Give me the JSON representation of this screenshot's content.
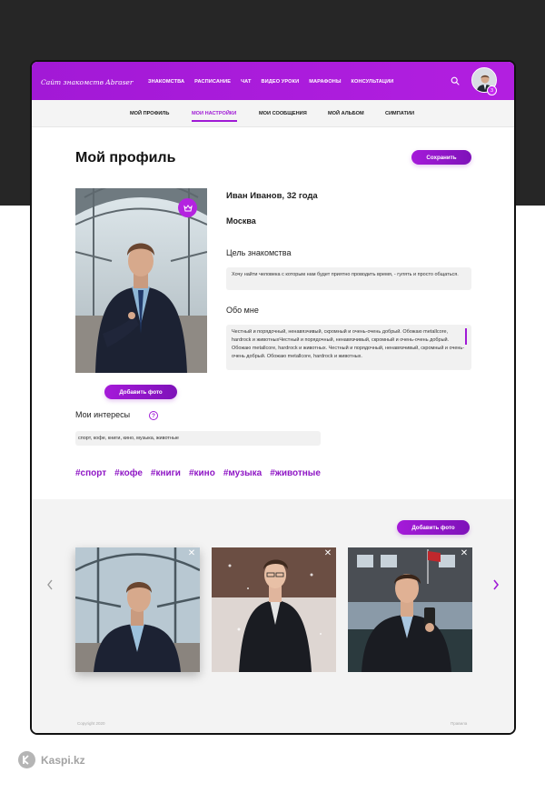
{
  "header": {
    "logo": "Сайт знакомств Abraser",
    "nav": [
      "ЗНАКОМСТВА",
      "РАСПИСАНИЕ",
      "ЧАТ",
      "ВИДЕО УРОКИ",
      "МАРАФОНЫ",
      "КОНСУЛЬТАЦИИ"
    ],
    "notification_count": "3"
  },
  "subnav": {
    "items": [
      "МОЙ ПРОФИЛЬ",
      "МОИ НАСТРОЙКИ",
      "МОИ СООБЩЕНИЯ",
      "МОЙ АЛЬБОМ",
      "СИМПАТИИ"
    ],
    "active": "МОИ НАСТРОЙКИ"
  },
  "profile": {
    "page_title": "Мой профиль",
    "save_label": "Сохранить",
    "name_age": "Иван Иванов, 32 года",
    "city": "Москва",
    "goal_label": "Цель знакомства",
    "goal_text": "Хочу найти человека с которым нам будет приятно проводить время, - гулять и просто общаться.",
    "about_label": "Обо мне",
    "about_text": "Честный и порядочный, ненавязчивый, скромный и очень-очень добрый. Обожаю metallcore, hardrock и животныхЧестный и порядочный, ненавязчивый, скромный и очень-очень добрый. Обожаю metallcore, hardrock и животных. Честный и порядочный, ненавязчивый, скромный и очень-очень добрый. Обожаю metallcore, hardrock и животных.",
    "add_photo_label": "Добавить фото",
    "interests_label": "Мои интересы",
    "interests_value": "спорт, кофе, книги, кино, музыка, животные",
    "tags": [
      "#спорт",
      "#кофе",
      "#книги",
      "#кино",
      "#музыка",
      "#животные"
    ]
  },
  "gallery": {
    "add_photo_label": "Добавить фото"
  },
  "footer": {
    "copyright": "Copyright 2020",
    "rules": "Правила"
  },
  "watermark": "Kaspi.kz",
  "colors": {
    "accent": "#a01ad6",
    "header": "#a51ad9",
    "dark_bg": "#262626",
    "gallery_bg": "#f3f3f3"
  }
}
